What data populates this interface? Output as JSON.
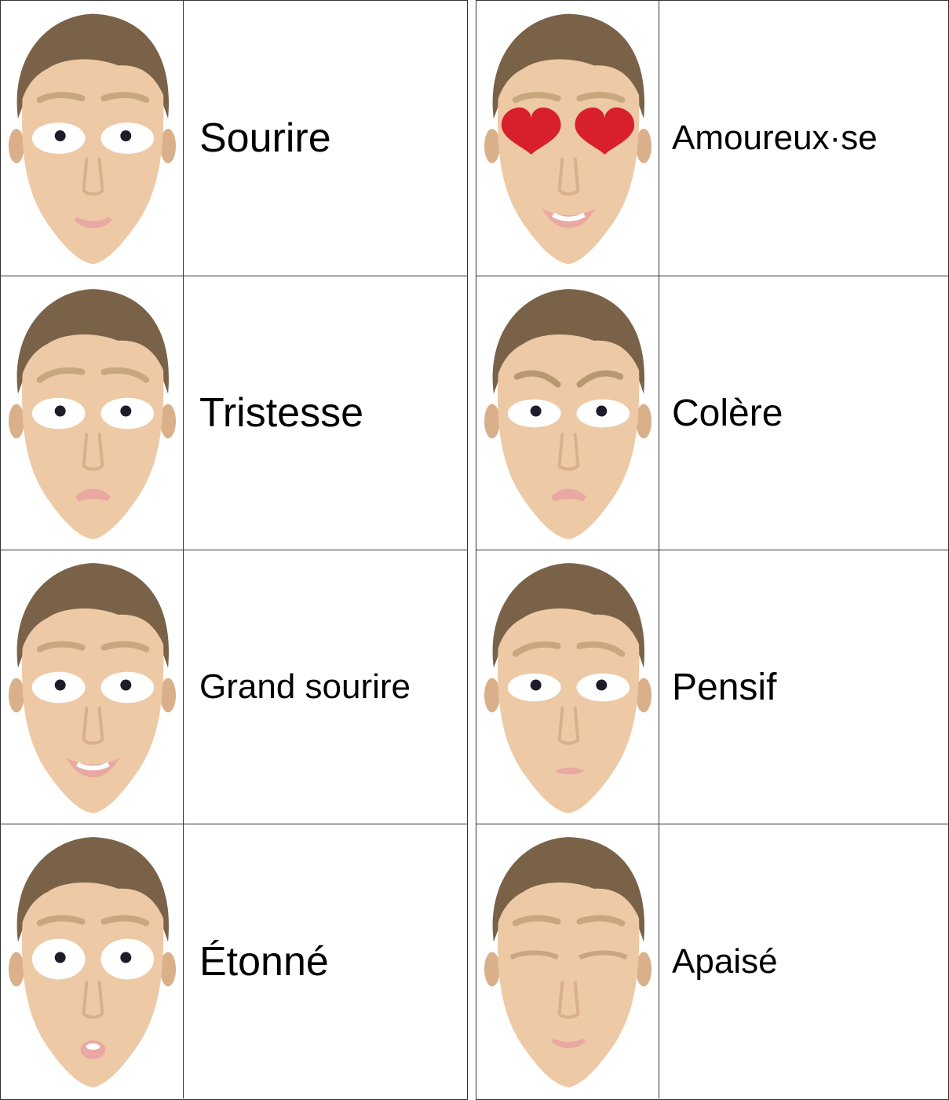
{
  "colors": {
    "skin": "#edc9a5",
    "skin_shadow": "#d9b08a",
    "hair": "#7a6248",
    "lip": "#e9a8a2",
    "heart": "#d8202a",
    "border": "#333333"
  },
  "columns": [
    {
      "rows": [
        {
          "label": "Sourire",
          "expression": "smile"
        },
        {
          "label": "Tristesse",
          "expression": "sad"
        },
        {
          "label": "Grand sourire",
          "expression": "big-smile"
        },
        {
          "label": "Étonné",
          "expression": "surprised"
        }
      ]
    },
    {
      "rows": [
        {
          "label": "Amoureux·se",
          "expression": "in-love"
        },
        {
          "label": "Colère",
          "expression": "angry"
        },
        {
          "label": "Pensif",
          "expression": "pensive"
        },
        {
          "label": "Apaisé",
          "expression": "calm"
        }
      ]
    }
  ]
}
